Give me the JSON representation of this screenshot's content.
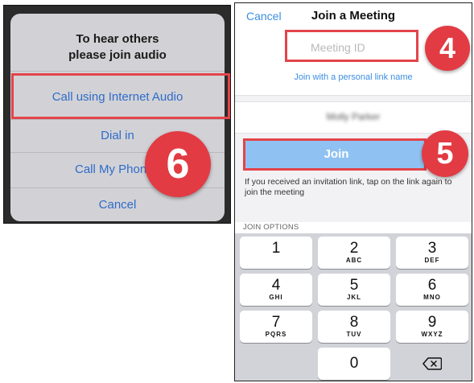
{
  "audio_dialog": {
    "title_line1": "To hear others",
    "title_line2": "please join audio",
    "options": [
      "Call using Internet Audio",
      "Dial in",
      "Call My Phone",
      "Cancel"
    ]
  },
  "join_meeting": {
    "nav": {
      "cancel": "Cancel",
      "title": "Join a Meeting"
    },
    "meeting_id_placeholder": "Meeting ID",
    "personal_link": "Join with a personal link name",
    "name_value": "Molly Parker",
    "join_button": "Join",
    "invitation_note": "If you received an invitation link, tap on the link again to join the meeting",
    "join_options_label": "JOIN OPTIONS"
  },
  "keypad": {
    "keys": [
      {
        "digit": "1",
        "letters": ""
      },
      {
        "digit": "2",
        "letters": "ABC"
      },
      {
        "digit": "3",
        "letters": "DEF"
      },
      {
        "digit": "4",
        "letters": "GHI"
      },
      {
        "digit": "5",
        "letters": "JKL"
      },
      {
        "digit": "6",
        "letters": "MNO"
      },
      {
        "digit": "7",
        "letters": "PQRS"
      },
      {
        "digit": "8",
        "letters": "TUV"
      },
      {
        "digit": "9",
        "letters": "WXYZ"
      },
      {
        "digit": "0",
        "letters": ""
      }
    ],
    "delete_icon": "backspace-icon"
  },
  "steps": {
    "step_4": "4",
    "step_5": "5",
    "step_6": "6"
  },
  "colors": {
    "accent_blue": "#3b8ee0",
    "join_button": "#8fc2f2",
    "callout_red": "#e3444a",
    "badge_red": "#e23b43"
  }
}
